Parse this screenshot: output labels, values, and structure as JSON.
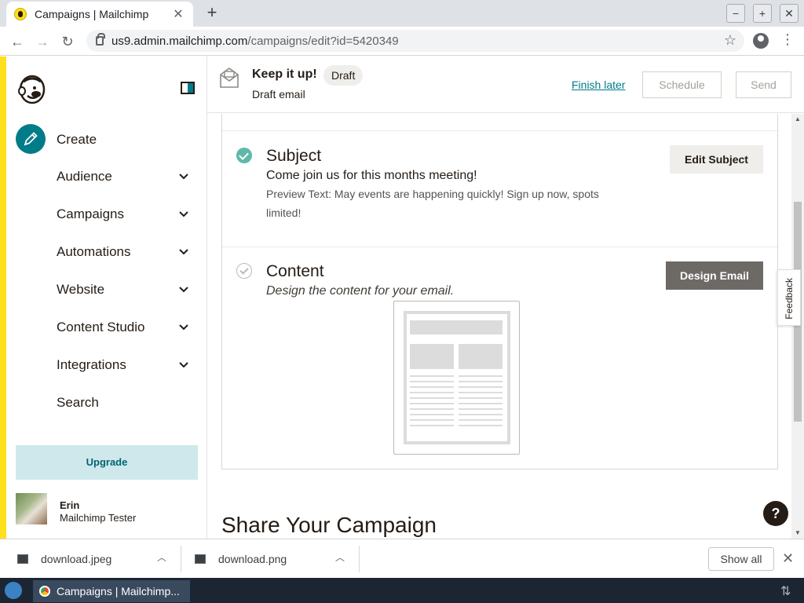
{
  "browser": {
    "tab_title": "Campaigns | Mailchimp",
    "url_host": "us9.admin.mailchimp.com",
    "url_path": "/campaigns/edit?id=5420349"
  },
  "sidebar": {
    "create_label": "Create",
    "items": [
      {
        "label": "Audience",
        "has_chevron": true
      },
      {
        "label": "Campaigns",
        "has_chevron": true
      },
      {
        "label": "Automations",
        "has_chevron": true
      },
      {
        "label": "Website",
        "has_chevron": true
      },
      {
        "label": "Content Studio",
        "has_chevron": true
      },
      {
        "label": "Integrations",
        "has_chevron": true
      },
      {
        "label": "Search",
        "has_chevron": false
      }
    ],
    "upgrade_label": "Upgrade",
    "user": {
      "name": "Erin",
      "role": "Mailchimp Tester"
    }
  },
  "header": {
    "title": "Keep it up!",
    "badge": "Draft",
    "subtitle": "Draft email",
    "finish_later": "Finish later",
    "schedule": "Schedule",
    "send": "Send"
  },
  "subject": {
    "title": "Subject",
    "line": "Come join us for this months meeting!",
    "preview": "Preview Text: May events are happening quickly! Sign up now, spots limited!",
    "button": "Edit Subject",
    "completed": true
  },
  "content": {
    "title": "Content",
    "description": "Design the content for your email.",
    "button": "Design Email",
    "completed": false
  },
  "share_title": "Share Your Campaign",
  "feedback_label": "Feedback",
  "help_label": "?",
  "downloads": {
    "items": [
      {
        "name": "download.jpeg"
      },
      {
        "name": "download.png"
      }
    ],
    "show_all": "Show all"
  },
  "taskbar": {
    "app_label": "Campaigns | Mailchimp..."
  },
  "colors": {
    "brand_yellow": "#ffe01b",
    "brand_teal": "#007c89",
    "success_green": "#5fb9a8",
    "dark_button": "#6d6a66"
  }
}
